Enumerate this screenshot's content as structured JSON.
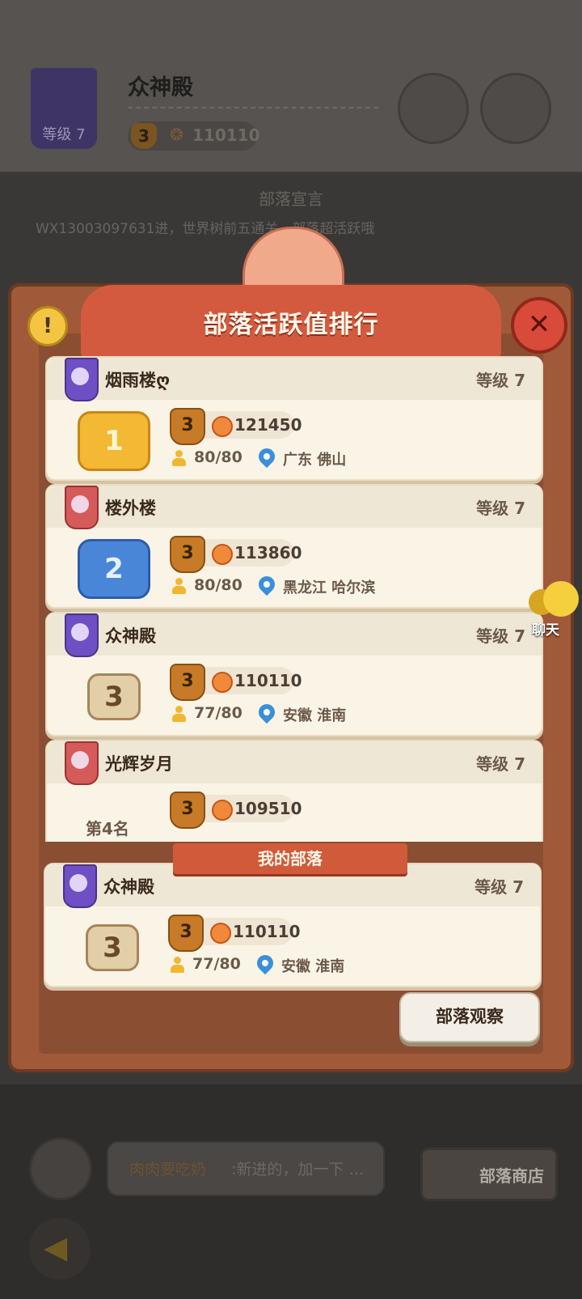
{
  "background": {
    "tribe_name": "众神殿",
    "banner_level": "等级 7",
    "tier": "3",
    "activity": "110110",
    "declaration_title": "部落宣言",
    "declaration_text": "WX13003097631进，世界树前五通关，部落超活跃哦",
    "chat_user": "肉肉要吃奶",
    "chat_text": ":新进的，加一下 …",
    "shop_label": "部落商店"
  },
  "modal": {
    "title": "部落活跃值排行",
    "info_glyph": "!",
    "close_glyph": "✕"
  },
  "ranking": [
    {
      "name": "烟雨楼ღ",
      "level": "等级 7",
      "rank": "1",
      "banner": "purple",
      "tier": "3",
      "score": "121450",
      "members": "80/80",
      "location": "广东 佛山"
    },
    {
      "name": "楼外楼",
      "level": "等级 7",
      "rank": "2",
      "banner": "red",
      "tier": "3",
      "score": "113860",
      "members": "80/80",
      "location": "黑龙江 哈尔滨"
    },
    {
      "name": "众神殿",
      "level": "等级 7",
      "rank": "3",
      "banner": "purple",
      "tier": "3",
      "score": "110110",
      "members": "77/80",
      "location": "安徽 淮南"
    },
    {
      "name": "光辉岁月",
      "level": "等级 7",
      "rank_text": "第4名",
      "banner": "red",
      "tier": "3",
      "score": "109510"
    }
  ],
  "my_tribe": {
    "section_label": "我的部落",
    "name": "众神殿",
    "level": "等级 7",
    "rank": "3",
    "tier": "3",
    "score": "110110",
    "members": "77/80",
    "location": "安徽 淮南"
  },
  "buttons": {
    "observe": "部落观察",
    "chat_float": "聊天"
  },
  "icons": {
    "banner": "tribe-banner-icon",
    "tier": "tier-shield-icon",
    "activity": "fire-icon",
    "members": "person-icon",
    "location": "location-pin-icon",
    "back": "back-arrow-icon",
    "chat": "chat-bubble-icon",
    "close": "close-icon",
    "info": "info-icon"
  },
  "colors": {
    "frame": "#a05a3a",
    "ribbon": "#d45a3f",
    "card": "#faf4e6",
    "gold": "#f3b834",
    "silver": "#4a86d8",
    "bronze": "#e2cfa8"
  }
}
